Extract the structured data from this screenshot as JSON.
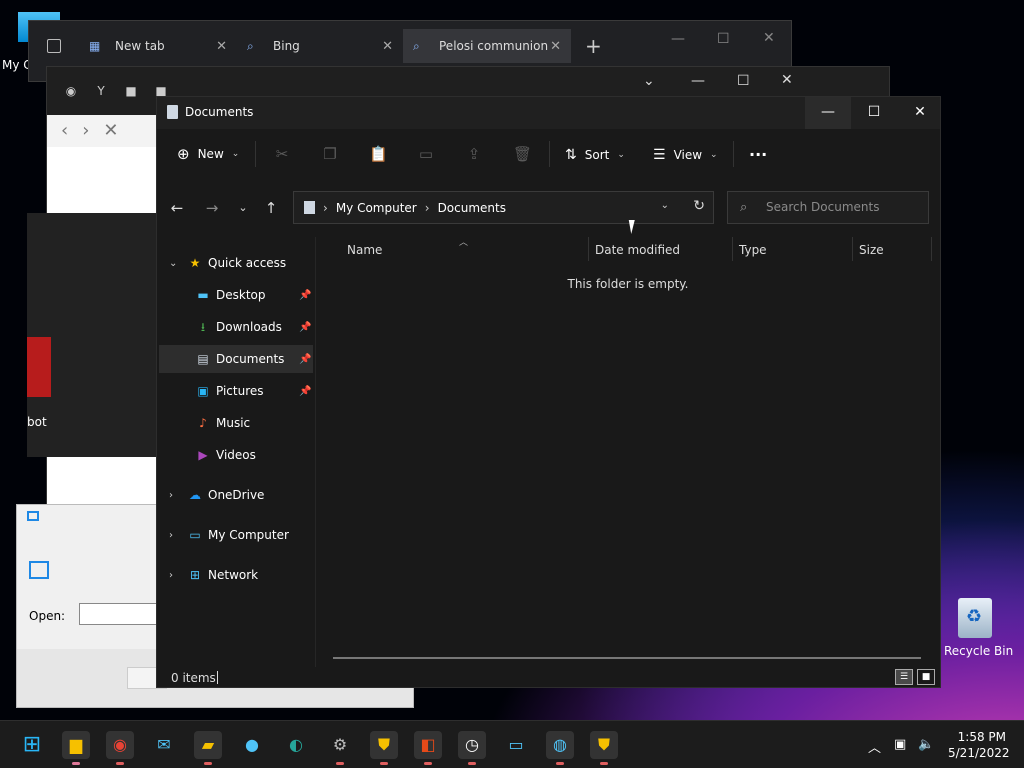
{
  "desktop": {
    "top_icon_label": "My C",
    "recycle_bin_label": "Recycle Bin"
  },
  "back_browser": {
    "tabs": [
      {
        "label": "New tab"
      },
      {
        "label": "Bing"
      },
      {
        "label": "Pelosi communion"
      }
    ]
  },
  "mid_browser": {
    "page_fragment_text": "bot"
  },
  "run_dialog": {
    "open_label": "Open:"
  },
  "explorer": {
    "title": "Documents",
    "toolbar": {
      "new_label": "New",
      "sort_label": "Sort",
      "view_label": "View",
      "more_label": "···"
    },
    "breadcrumb": [
      "My Computer",
      "Documents"
    ],
    "search_placeholder": "Search Documents",
    "sidebar": {
      "quick_access": "Quick access",
      "items": [
        {
          "label": "Desktop"
        },
        {
          "label": "Downloads"
        },
        {
          "label": "Documents"
        },
        {
          "label": "Pictures"
        },
        {
          "label": "Music"
        },
        {
          "label": "Videos"
        }
      ],
      "onedrive": "OneDrive",
      "my_computer": "My Computer",
      "network": "Network"
    },
    "columns": {
      "name": "Name",
      "date_modified": "Date modified",
      "type": "Type",
      "size": "Size"
    },
    "empty_message": "This folder is empty.",
    "status": "0 items"
  },
  "taskbar": {
    "time": "1:58 PM",
    "date": "5/21/2022"
  }
}
